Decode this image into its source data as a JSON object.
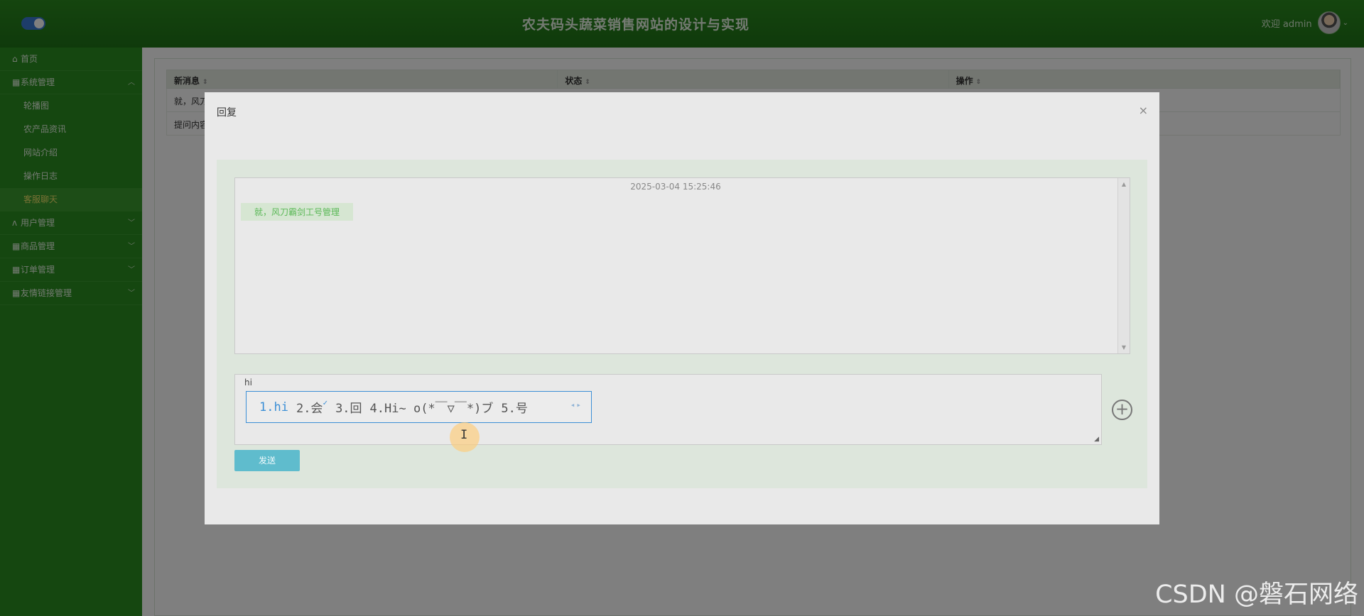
{
  "header": {
    "site_title": "农夫码头蔬菜销售网站的设计与实现",
    "welcome_text": "欢迎 admin",
    "caret": "⌄"
  },
  "sidebar": {
    "items": [
      {
        "label": "首页",
        "icon": "home-icon",
        "glyph": "⌂"
      },
      {
        "label": "系统管理",
        "icon": "grid-icon",
        "glyph": "▦",
        "expanded": true,
        "arrow": "︿"
      },
      {
        "label": "轮播图"
      },
      {
        "label": "农产品资讯"
      },
      {
        "label": "网站介绍"
      },
      {
        "label": "操作日志"
      },
      {
        "label": "客服聊天",
        "active": true
      },
      {
        "label": "用户管理",
        "icon": "user-icon",
        "glyph": "ᴧ",
        "arrow": "﹀"
      },
      {
        "label": "商品管理",
        "icon": "grid-icon",
        "glyph": "▦",
        "arrow": "﹀"
      },
      {
        "label": "订单管理",
        "icon": "grid-icon",
        "glyph": "▦",
        "arrow": "﹀"
      },
      {
        "label": "友情链接管理",
        "icon": "grid-icon",
        "glyph": "▦",
        "arrow": "﹀"
      }
    ]
  },
  "table": {
    "columns": [
      "新消息",
      "状态",
      "操作"
    ],
    "sort_glyph": "⇕",
    "rows": [
      [
        "就，风刀",
        "",
        ""
      ],
      [
        "提问内容",
        "",
        ""
      ]
    ]
  },
  "modal": {
    "title": "回复",
    "close": "×",
    "chat_time": "2025-03-04 15:25:46",
    "chat_message": "就，风刀霸剑工号管理",
    "typed_text": "hi",
    "ime_candidates": [
      "1.hi",
      "2.会",
      "3.回",
      "4.Hi~ o(*￣▽￣*)ブ",
      "5.号"
    ],
    "ime_nav": "◂▸",
    "add_glyph": "+",
    "send_label": "发送",
    "scroll_up": "▲",
    "scroll_down": "▼"
  },
  "cursor_glyph": "I",
  "watermark": "CSDN @磐石网络"
}
